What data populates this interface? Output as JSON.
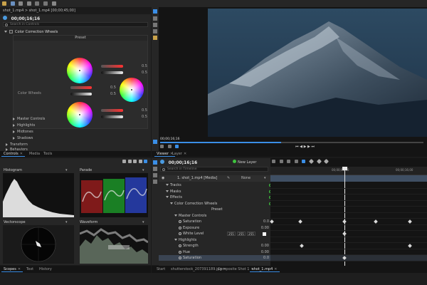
{
  "app": {
    "title": "shot_1.mp4 > shot_1.mp4 [00;00;45;00]"
  },
  "controls": {
    "timecode": "00;00;16;16",
    "search_placeholder": "Search in Controls",
    "section_title": "Color Correction Wheels",
    "preset_label": "Preset",
    "color_wheels_label": "Color Wheels",
    "slider_values": [
      "0.5",
      "0.5",
      "0.5",
      "0.5",
      "0.5",
      "0.5"
    ],
    "tree": [
      "Master Controls",
      "Highlights",
      "Midtones",
      "Shadows"
    ],
    "transform": "Transform",
    "behaviors": "Behaviors",
    "tabs": [
      "Controls",
      "Media",
      "Tools"
    ]
  },
  "viewer": {
    "timecode": "00;00;16;16",
    "tabs": [
      "Viewer",
      "Layer"
    ]
  },
  "scopes": {
    "histogram": "Histogram",
    "parade": "Parade",
    "vectorscope": "Vectorscope",
    "waveform": "Waveform",
    "tabs": [
      "Scopes",
      "Text",
      "History"
    ]
  },
  "timeline": {
    "timecode": "00;00;16;16",
    "new_layer": "New Layer",
    "search_placeholder": "Search in Timeline",
    "clip_name": "1. shot_1.mp4 [Media]",
    "blend_mode": "None",
    "ruler": [
      "00;00;08;00",
      "00;00;16;00"
    ],
    "rows": [
      {
        "label": "Tracks",
        "indent": 6
      },
      {
        "label": "Masks",
        "indent": 6
      },
      {
        "label": "Effects",
        "indent": 6
      },
      {
        "label": "Color Correction Wheels",
        "indent": 12
      },
      {
        "label": "Preset",
        "indent": 0,
        "center": true
      },
      {
        "label": "Master Controls",
        "indent": 18
      },
      {
        "label": "Saturation",
        "indent": 24,
        "value": "0.0"
      },
      {
        "label": "Exposure",
        "indent": 24,
        "value": "0.00"
      },
      {
        "label": "White Level",
        "indent": 24
      },
      {
        "label": "Highlights",
        "indent": 18
      },
      {
        "label": "Strength",
        "indent": 24,
        "value": "0.00"
      },
      {
        "label": "Hue",
        "indent": 24,
        "value": "0.00"
      },
      {
        "label": "Saturation",
        "indent": 24,
        "value": "0.0"
      }
    ],
    "white_level": [
      "255",
      "255",
      "255"
    ],
    "tabs": [
      "Start",
      "shutterstock_207391189.jpg",
      "Composite Shot 1",
      "shot_1.mp4"
    ]
  },
  "colors": {
    "accent": "#3a8ee6",
    "green": "#3ec43e",
    "panel": "#262626",
    "background": "#1b1b1b"
  }
}
